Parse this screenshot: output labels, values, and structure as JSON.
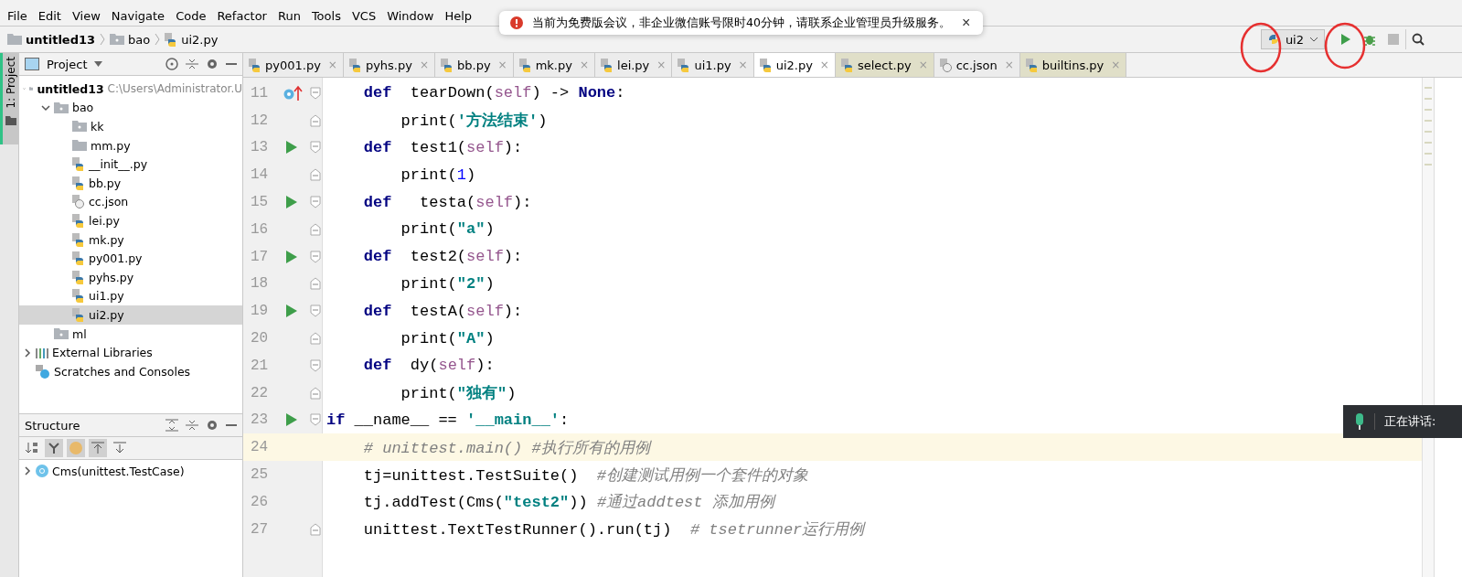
{
  "menu": [
    "File",
    "Edit",
    "View",
    "Navigate",
    "Code",
    "Refactor",
    "Run",
    "Tools",
    "VCS",
    "Window",
    "Help"
  ],
  "notification": {
    "text": "当前为免费版会议，非企业微信账号限时40分钟，请联系企业管理员升级服务。",
    "close": "×"
  },
  "breadcrumbs": [
    {
      "label": "untitled13",
      "kind": "folder"
    },
    {
      "label": "bao",
      "kind": "package"
    },
    {
      "label": "ui2.py",
      "kind": "py"
    }
  ],
  "run_config": {
    "label": "ui2"
  },
  "project_panel": {
    "title": "Project",
    "stripe_label": "1: Project"
  },
  "tree": [
    {
      "label": "untitled13",
      "note": "C:\\Users\\Administrator.U",
      "kind": "folder",
      "expanded": true,
      "selected": false,
      "children": [
        {
          "label": "bao",
          "kind": "package",
          "expanded": true,
          "selected": false,
          "children": [
            {
              "label": "kk",
              "kind": "package",
              "selected": false
            },
            {
              "label": "mm.py",
              "kind": "folder",
              "selected": false
            },
            {
              "label": "__init__.py",
              "kind": "py",
              "selected": false
            },
            {
              "label": "bb.py",
              "kind": "py",
              "selected": false
            },
            {
              "label": "cc.json",
              "kind": "json",
              "selected": false
            },
            {
              "label": "lei.py",
              "kind": "py",
              "selected": false
            },
            {
              "label": "mk.py",
              "kind": "py",
              "selected": false
            },
            {
              "label": "py001.py",
              "kind": "py",
              "selected": false
            },
            {
              "label": "pyhs.py",
              "kind": "py",
              "selected": false
            },
            {
              "label": "ui1.py",
              "kind": "py",
              "selected": false
            },
            {
              "label": "ui2.py",
              "kind": "py",
              "selected": true
            }
          ]
        },
        {
          "label": "ml",
          "kind": "package",
          "selected": false
        }
      ]
    },
    {
      "label": "External Libraries",
      "kind": "library",
      "expanded": false,
      "selected": false
    },
    {
      "label": "Scratches and Consoles",
      "kind": "scratches",
      "selected": false
    }
  ],
  "structure": {
    "title": "Structure",
    "items": [
      {
        "label": "Cms(unittest.TestCase)",
        "expanded": false
      }
    ]
  },
  "tabs": [
    {
      "label": "py001.py",
      "kind": "py",
      "close": "×",
      "selected": false,
      "tinted": false
    },
    {
      "label": "pyhs.py",
      "kind": "py",
      "close": "×",
      "selected": false,
      "tinted": false
    },
    {
      "label": "bb.py",
      "kind": "py",
      "close": "×",
      "selected": false,
      "tinted": false
    },
    {
      "label": "mk.py",
      "kind": "py",
      "close": "×",
      "selected": false,
      "tinted": false
    },
    {
      "label": "lei.py",
      "kind": "py",
      "close": "×",
      "selected": false,
      "tinted": false
    },
    {
      "label": "ui1.py",
      "kind": "py",
      "close": "×",
      "selected": false,
      "tinted": false
    },
    {
      "label": "ui2.py",
      "kind": "py",
      "close": "×",
      "selected": true,
      "tinted": false
    },
    {
      "label": "select.py",
      "kind": "py",
      "close": "×",
      "selected": false,
      "tinted": true
    },
    {
      "label": "cc.json",
      "kind": "json",
      "close": "×",
      "selected": false,
      "tinted": false
    },
    {
      "label": "builtins.py",
      "kind": "py",
      "close": "×",
      "selected": false,
      "tinted": true
    }
  ],
  "code": [
    {
      "n": "11",
      "marker": {
        "kind": "override"
      },
      "fold": {
        "kind": "start"
      },
      "current": false,
      "tokens": [
        {
          "t": "    def",
          "kind": "kw"
        },
        {
          "t": "  tearDown(",
          "kind": "plain"
        },
        {
          "t": "self",
          "kind": "self"
        },
        {
          "t": ") -> ",
          "kind": "plain"
        },
        {
          "t": "None",
          "kind": "kw"
        },
        {
          "t": ":",
          "kind": "plain"
        }
      ]
    },
    {
      "n": "12",
      "fold": {
        "kind": "end"
      },
      "current": false,
      "tokens": [
        {
          "t": "        print(",
          "kind": "plain"
        },
        {
          "t": "'方法结束'",
          "kind": "str"
        },
        {
          "t": ")",
          "kind": "plain"
        }
      ]
    },
    {
      "n": "13",
      "marker": {
        "kind": "run"
      },
      "fold": {
        "kind": "start"
      },
      "current": false,
      "tokens": [
        {
          "t": "    def",
          "kind": "kw"
        },
        {
          "t": "  test1(",
          "kind": "plain"
        },
        {
          "t": "self",
          "kind": "self"
        },
        {
          "t": "):",
          "kind": "plain"
        }
      ]
    },
    {
      "n": "14",
      "fold": {
        "kind": "end"
      },
      "current": false,
      "tokens": [
        {
          "t": "        print(",
          "kind": "plain"
        },
        {
          "t": "1",
          "kind": "num"
        },
        {
          "t": ")",
          "kind": "plain"
        }
      ]
    },
    {
      "n": "15",
      "marker": {
        "kind": "run"
      },
      "fold": {
        "kind": "start"
      },
      "current": false,
      "tokens": [
        {
          "t": "    def",
          "kind": "kw"
        },
        {
          "t": "   testa(",
          "kind": "plain"
        },
        {
          "t": "self",
          "kind": "self"
        },
        {
          "t": "):",
          "kind": "plain"
        }
      ]
    },
    {
      "n": "16",
      "fold": {
        "kind": "end"
      },
      "current": false,
      "tokens": [
        {
          "t": "        print(",
          "kind": "plain"
        },
        {
          "t": "\"a\"",
          "kind": "str"
        },
        {
          "t": ")",
          "kind": "plain"
        }
      ]
    },
    {
      "n": "17",
      "marker": {
        "kind": "run"
      },
      "fold": {
        "kind": "start"
      },
      "current": false,
      "tokens": [
        {
          "t": "    def",
          "kind": "kw"
        },
        {
          "t": "  test2(",
          "kind": "plain"
        },
        {
          "t": "self",
          "kind": "self"
        },
        {
          "t": "):",
          "kind": "plain"
        }
      ]
    },
    {
      "n": "18",
      "fold": {
        "kind": "end"
      },
      "current": false,
      "tokens": [
        {
          "t": "        print(",
          "kind": "plain"
        },
        {
          "t": "\"2\"",
          "kind": "str"
        },
        {
          "t": ")",
          "kind": "plain"
        }
      ]
    },
    {
      "n": "19",
      "marker": {
        "kind": "run"
      },
      "fold": {
        "kind": "start"
      },
      "current": false,
      "tokens": [
        {
          "t": "    def",
          "kind": "kw"
        },
        {
          "t": "  testA(",
          "kind": "plain"
        },
        {
          "t": "self",
          "kind": "self"
        },
        {
          "t": "):",
          "kind": "plain"
        }
      ]
    },
    {
      "n": "20",
      "fold": {
        "kind": "end"
      },
      "current": false,
      "tokens": [
        {
          "t": "        print(",
          "kind": "plain"
        },
        {
          "t": "\"A\"",
          "kind": "str"
        },
        {
          "t": ")",
          "kind": "plain"
        }
      ]
    },
    {
      "n": "21",
      "fold": {
        "kind": "start"
      },
      "current": false,
      "tokens": [
        {
          "t": "    def",
          "kind": "kw"
        },
        {
          "t": "  dy(",
          "kind": "plain"
        },
        {
          "t": "self",
          "kind": "self"
        },
        {
          "t": "):",
          "kind": "plain"
        }
      ]
    },
    {
      "n": "22",
      "fold": {
        "kind": "end"
      },
      "current": false,
      "tokens": [
        {
          "t": "        print(",
          "kind": "plain"
        },
        {
          "t": "\"独有\"",
          "kind": "str"
        },
        {
          "t": ")",
          "kind": "plain"
        }
      ]
    },
    {
      "n": "23",
      "marker": {
        "kind": "run"
      },
      "fold": {
        "kind": "start"
      },
      "current": false,
      "tokens": [
        {
          "t": "if",
          "kind": "kw"
        },
        {
          "t": " __name__ == ",
          "kind": "plain"
        },
        {
          "t": "'__main__'",
          "kind": "str"
        },
        {
          "t": ":",
          "kind": "plain"
        }
      ]
    },
    {
      "n": "24",
      "current": true,
      "tokens": [
        {
          "t": "    # unittest.main() #执行所有的用例",
          "kind": "comment"
        }
      ]
    },
    {
      "n": "25",
      "current": false,
      "tokens": [
        {
          "t": "    tj=unittest.TestSuite()  ",
          "kind": "plain"
        },
        {
          "t": "#创建测试用例一个套件的对象",
          "kind": "comment"
        }
      ]
    },
    {
      "n": "26",
      "current": false,
      "tokens": [
        {
          "t": "    tj.addTest(Cms(",
          "kind": "plain"
        },
        {
          "t": "\"test2\"",
          "kind": "str"
        },
        {
          "t": ")) ",
          "kind": "plain"
        },
        {
          "t": "#通过addtest 添加用例",
          "kind": "comment"
        }
      ]
    },
    {
      "n": "27",
      "fold": {
        "kind": "end"
      },
      "current": false,
      "tokens": [
        {
          "t": "    unittest.TextTestRunner().run(tj)  ",
          "kind": "plain"
        },
        {
          "t": "# tsetrunner运行用例",
          "kind": "comment"
        }
      ]
    }
  ],
  "speaking": {
    "label": "正在讲话:"
  }
}
